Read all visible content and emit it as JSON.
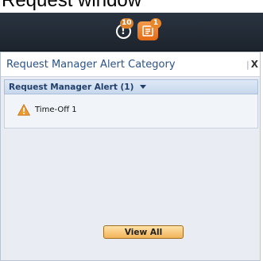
{
  "page": {
    "heading": "Request window"
  },
  "topbar": {
    "alert_button": {
      "icon": "alert-circle-icon",
      "glyph": "!",
      "badge": "10"
    },
    "request_button": {
      "icon": "request-document-icon",
      "badge": "1"
    }
  },
  "panel": {
    "title": "Request Manager Alert Category",
    "close_label": "X",
    "group": {
      "label": "Request Manager Alert (1)",
      "items": [
        {
          "icon": "warning-icon",
          "text": "Time-Off  1"
        }
      ]
    },
    "view_all_label": "View All"
  },
  "colors": {
    "topbar": "#1f2731",
    "accent_orange": "#e8862a",
    "title_blue": "#2c5186",
    "panel_bg": "#e9edf3"
  }
}
